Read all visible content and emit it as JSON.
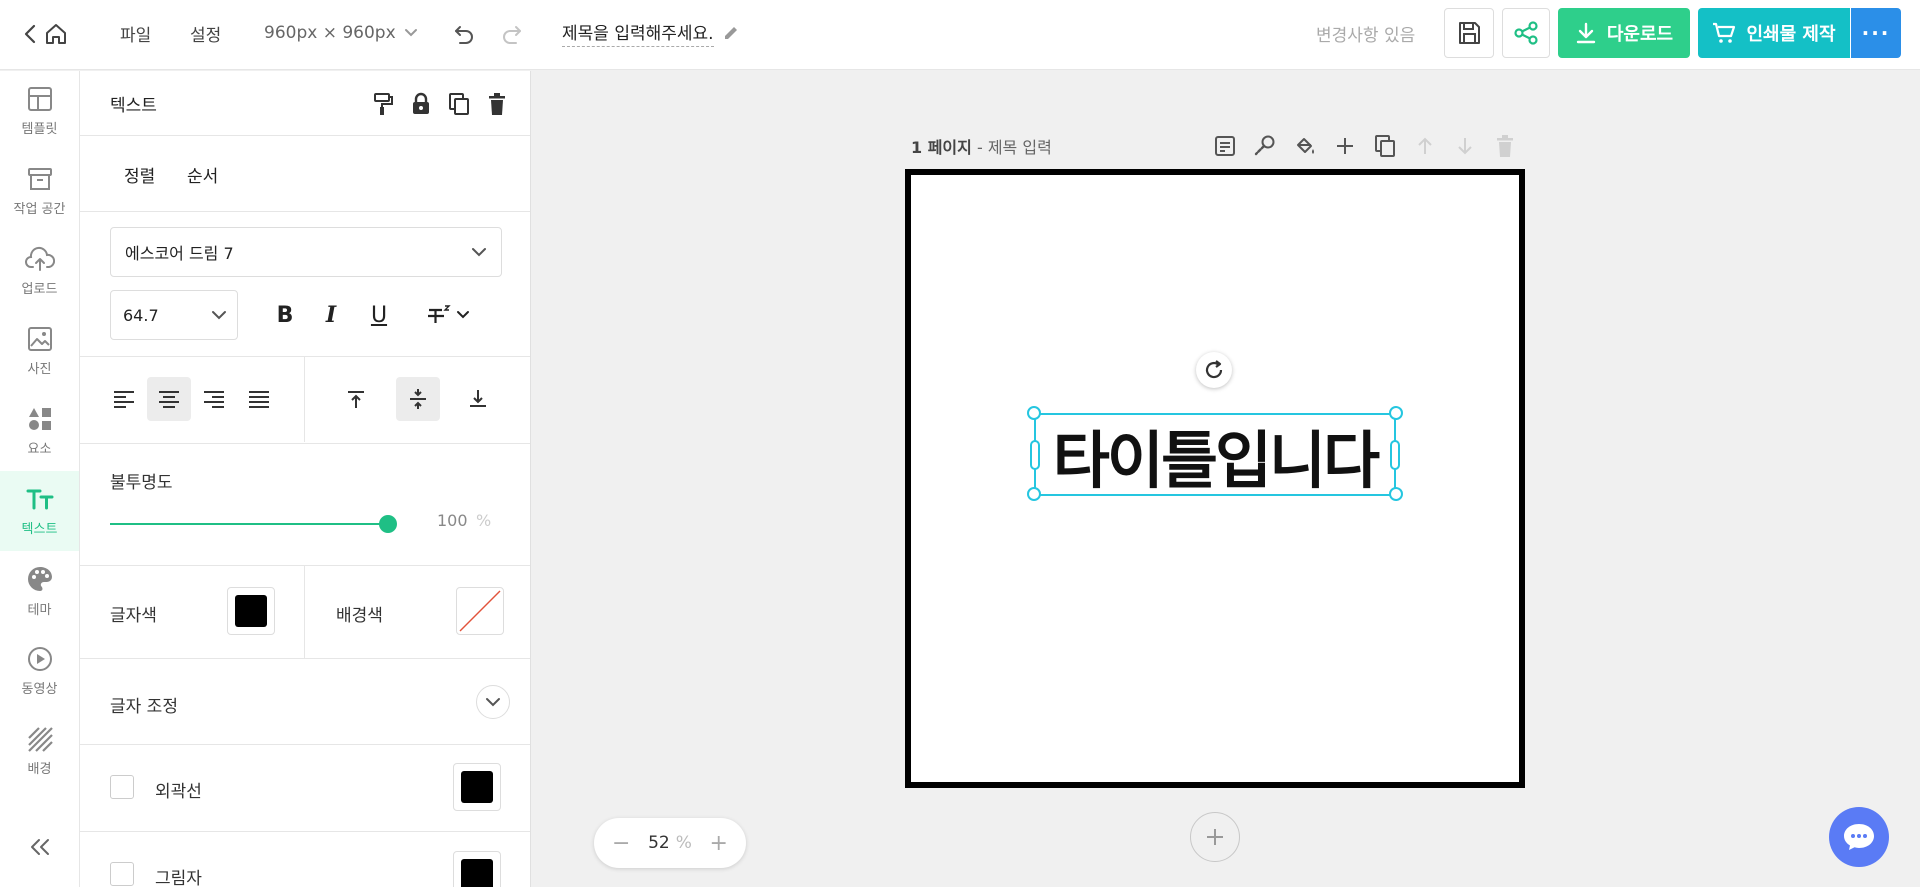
{
  "colors": {
    "accent": "#1fbf85",
    "download": "#2ecf8b",
    "print": "#14c0c6",
    "more": "#2b8fe8",
    "selection": "#25c6e0",
    "chat": "#5a7bf5"
  },
  "topbar": {
    "menu_file": "파일",
    "menu_settings": "설정",
    "canvas_size": "960px × 960px",
    "doc_title": "제목을 입력해주세요.",
    "status": "변경사항 있음",
    "download_label": "다운로드",
    "print_label": "인쇄물 제작",
    "more_label": "···"
  },
  "rail": {
    "items": [
      {
        "label": "템플릿",
        "icon": "layout-icon"
      },
      {
        "label": "작업 공간",
        "icon": "archive-icon"
      },
      {
        "label": "업로드",
        "icon": "cloud-upload-icon"
      },
      {
        "label": "사진",
        "icon": "image-icon"
      },
      {
        "label": "요소",
        "icon": "shapes-icon"
      },
      {
        "label": "텍스트",
        "icon": "text-icon"
      },
      {
        "label": "테마",
        "icon": "palette-icon"
      },
      {
        "label": "동영상",
        "icon": "play-icon"
      },
      {
        "label": "배경",
        "icon": "hatch-icon"
      }
    ],
    "active": "텍스트"
  },
  "panel": {
    "title": "텍스트",
    "tab_align": "정렬",
    "tab_order": "순서",
    "font_family": "에스코어 드림 7",
    "font_size": "64.7",
    "bold_label": "B",
    "italic_label": "I",
    "underline_label": "U",
    "opacity_label": "불투명도",
    "opacity_value": "100",
    "opacity_unit": "%",
    "opacity_fraction": 1.0,
    "text_color_label": "글자색",
    "text_color": "#000000",
    "bg_color_label": "배경색",
    "adjust_label": "글자 조정",
    "outline_label": "외곽선",
    "outline_color": "#000000",
    "shadow_label": "그림자",
    "shadow_color": "#000000"
  },
  "canvas": {
    "page_number": "1 페이지",
    "page_title": "- 제목 입력",
    "text_content": "타이틀입니다",
    "zoom_value": "52",
    "zoom_unit": "%"
  }
}
